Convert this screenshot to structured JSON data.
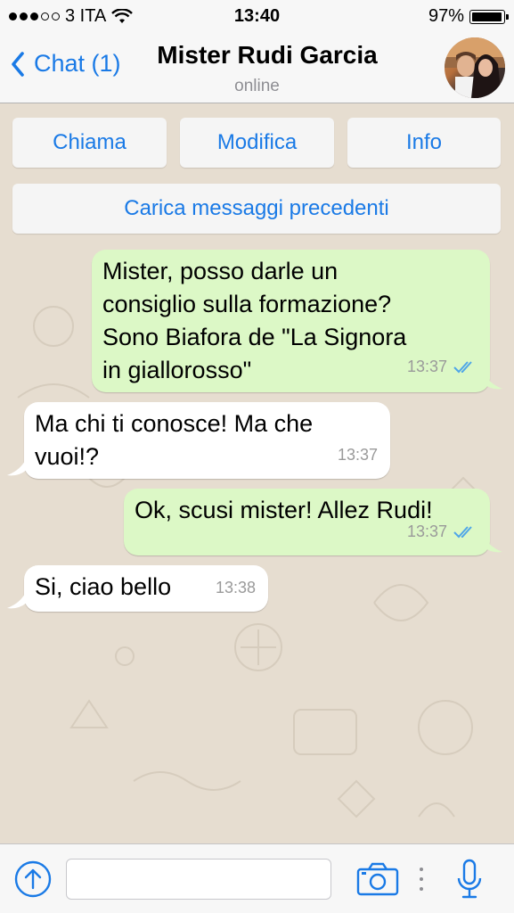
{
  "status_bar": {
    "carrier": "3 ITA",
    "signal_bars_filled": 3,
    "signal_bars_total": 5,
    "time": "13:40",
    "battery_percent": "97%",
    "battery_level": 0.97
  },
  "nav": {
    "back_label": "Chat (1)",
    "contact_name": "Mister Rudi Garcia",
    "contact_status": "online"
  },
  "actions": {
    "call": "Chiama",
    "edit": "Modifica",
    "info": "Info",
    "load_earlier": "Carica messaggi precedenti"
  },
  "messages": [
    {
      "direction": "outgoing",
      "text": "Mister, posso darle un\nconsiglio sulla formazione?\nSono Biafora de \"La Signora\nin giallorosso\"",
      "time": "13:37",
      "read": true
    },
    {
      "direction": "incoming",
      "text": "Ma chi ti conosce! Ma che\nvuoi!?",
      "time": "13:37"
    },
    {
      "direction": "outgoing",
      "text": "Ok, scusi mister! Allez Rudi!",
      "time": "13:37",
      "read": true
    },
    {
      "direction": "incoming",
      "text": "Si, ciao bello",
      "time": "13:38"
    }
  ],
  "input": {
    "placeholder": ""
  },
  "colors": {
    "accent": "#1a7ae6",
    "outgoing_bubble": "#dcf8c6",
    "incoming_bubble": "#ffffff",
    "read_ticks": "#4fa6e8",
    "wallpaper": "#e6ddd0"
  },
  "icons": [
    "back-chevron-icon",
    "wifi-icon",
    "double-check-icon",
    "upload-icon",
    "camera-icon",
    "microphone-icon"
  ]
}
